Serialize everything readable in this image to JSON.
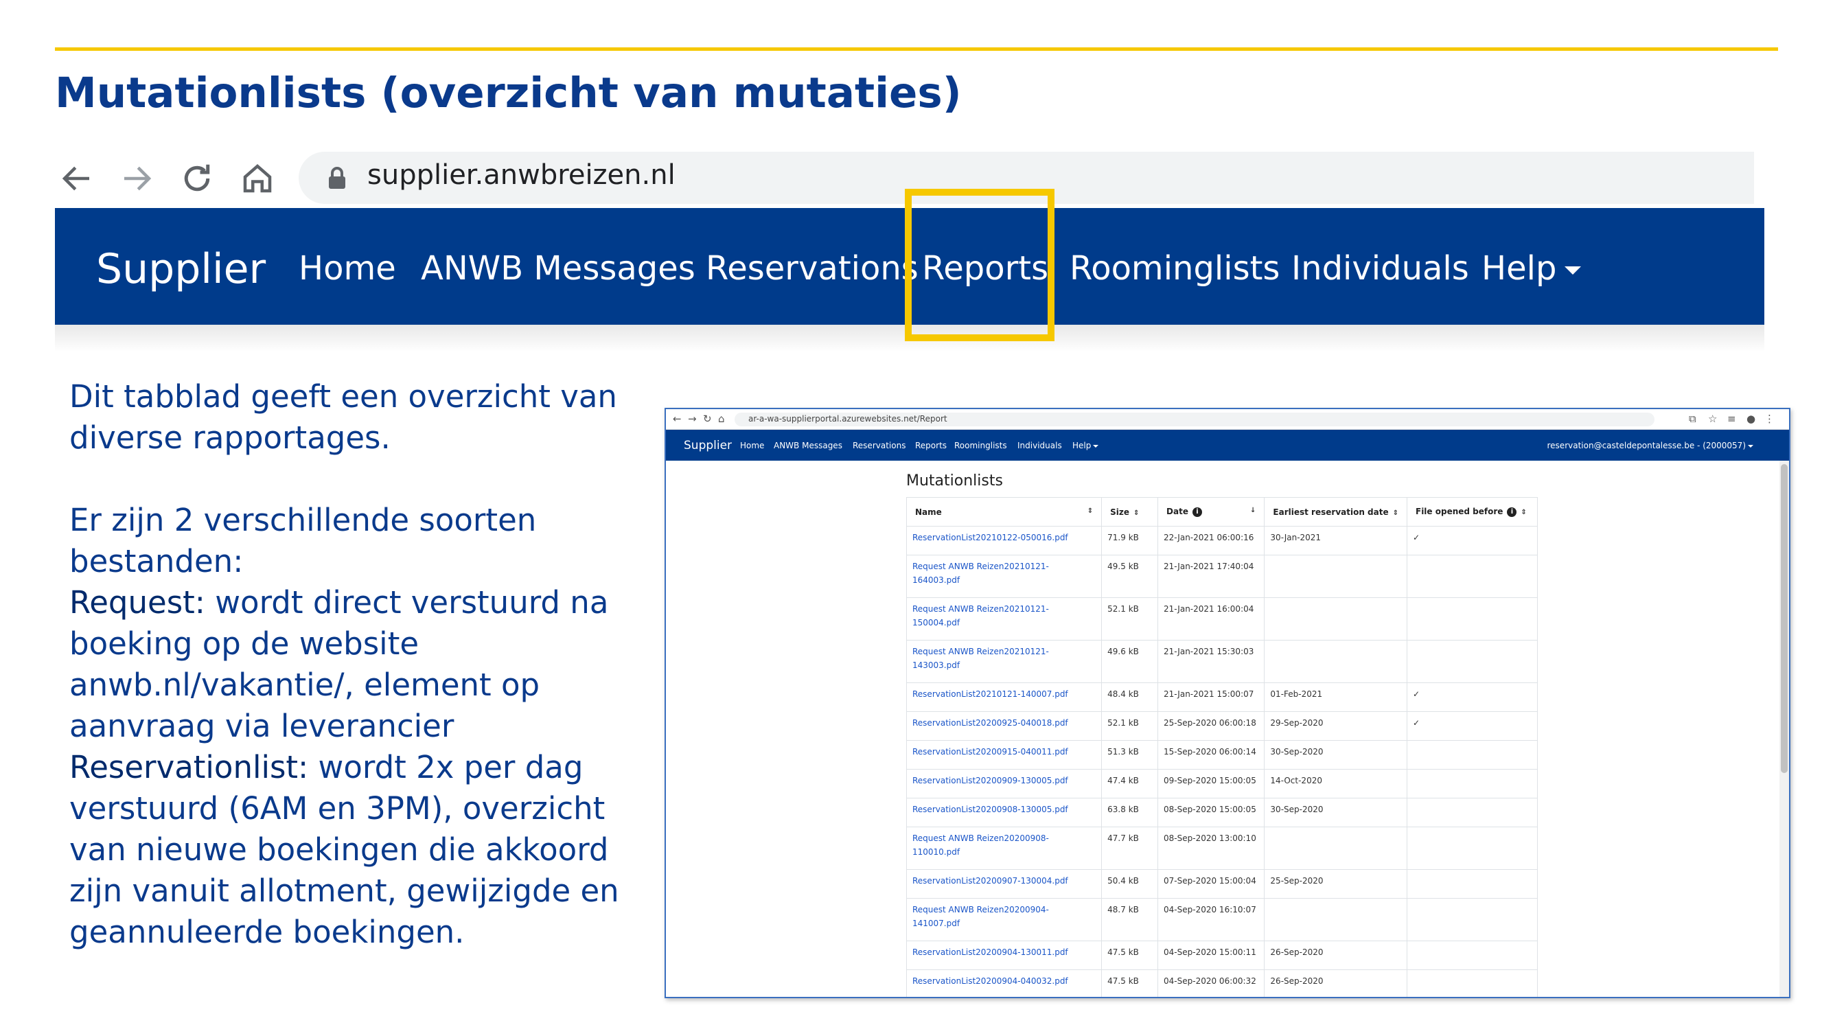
{
  "slide": {
    "title": "Mutationlists (overzicht van mutaties)",
    "accent_color": "#f6c800",
    "title_color": "#0a3a8c"
  },
  "browser": {
    "url": "supplier.anwbreizen.nl",
    "icons": [
      "back-icon",
      "forward-icon",
      "reload-icon",
      "home-icon",
      "lock-icon"
    ]
  },
  "nav": {
    "brand": "Supplier",
    "items": [
      "Home",
      "ANWB Messages",
      "Reservations",
      "Reports",
      "Roominglists",
      "Individuals",
      "Help"
    ],
    "highlighted": "Reports",
    "bg_color": "#003b8b"
  },
  "description": {
    "intro": "Dit tabblad geeft een overzicht van diverse rapportages.",
    "types_intro": "Er zijn 2 verschillende soorten bestanden:",
    "request_term": "Request:",
    "request_text": " wordt direct verstuurd na boeking op de website anwb.nl/vakantie/, element op aanvraag via leverancier",
    "reservationlist_term": "Reservationlist:",
    "reservationlist_text": " wordt 2x per dag verstuurd (6AM en 3PM), overzicht van nieuwe boekingen die akkoord zijn vanuit allotment, gewijzigde en geannuleerde boekingen."
  },
  "screenshot": {
    "url": "ar-a-wa-supplierportal.azurewebsites.net/Report",
    "nav_brand": "Supplier",
    "nav_items": [
      "Home",
      "ANWB Messages",
      "Reservations",
      "Reports",
      "Roominglists",
      "Individuals",
      "Help"
    ],
    "user": "reservation@casteldepontalesse.be - (2000057)",
    "title": "Mutationlists",
    "columns": [
      "Name",
      "Size",
      "Date",
      "Earliest reservation date",
      "File opened before"
    ],
    "rows": [
      {
        "name": "ReservationList20210122-050016.pdf",
        "size": "71.9 kB",
        "date": "22-Jan-2021 06:00:16",
        "earliest": "30-Jan-2021",
        "opened": "✓",
        "tall": false
      },
      {
        "name": "Request ANWB Reizen20210121-164003.pdf",
        "size": "49.5 kB",
        "date": "21-Jan-2021 17:40:04",
        "earliest": "",
        "opened": "",
        "tall": true
      },
      {
        "name": "Request ANWB Reizen20210121-150004.pdf",
        "size": "52.1 kB",
        "date": "21-Jan-2021 16:00:04",
        "earliest": "",
        "opened": "",
        "tall": true
      },
      {
        "name": "Request ANWB Reizen20210121-143003.pdf",
        "size": "49.6 kB",
        "date": "21-Jan-2021 15:30:03",
        "earliest": "",
        "opened": "",
        "tall": true
      },
      {
        "name": "ReservationList20210121-140007.pdf",
        "size": "48.4 kB",
        "date": "21-Jan-2021 15:00:07",
        "earliest": "01-Feb-2021",
        "opened": "✓",
        "tall": false
      },
      {
        "name": "ReservationList20200925-040018.pdf",
        "size": "52.1 kB",
        "date": "25-Sep-2020 06:00:18",
        "earliest": "29-Sep-2020",
        "opened": "✓",
        "tall": false
      },
      {
        "name": "ReservationList20200915-040011.pdf",
        "size": "51.3 kB",
        "date": "15-Sep-2020 06:00:14",
        "earliest": "30-Sep-2020",
        "opened": "",
        "tall": false
      },
      {
        "name": "ReservationList20200909-130005.pdf",
        "size": "47.4 kB",
        "date": "09-Sep-2020 15:00:05",
        "earliest": "14-Oct-2020",
        "opened": "",
        "tall": false
      },
      {
        "name": "ReservationList20200908-130005.pdf",
        "size": "63.8 kB",
        "date": "08-Sep-2020 15:00:05",
        "earliest": "30-Sep-2020",
        "opened": "",
        "tall": false
      },
      {
        "name": "Request ANWB Reizen20200908-110010.pdf",
        "size": "47.7 kB",
        "date": "08-Sep-2020 13:00:10",
        "earliest": "",
        "opened": "",
        "tall": true
      },
      {
        "name": "ReservationList20200907-130004.pdf",
        "size": "50.4 kB",
        "date": "07-Sep-2020 15:00:04",
        "earliest": "25-Sep-2020",
        "opened": "",
        "tall": false
      },
      {
        "name": "Request ANWB Reizen20200904-141007.pdf",
        "size": "48.7 kB",
        "date": "04-Sep-2020 16:10:07",
        "earliest": "",
        "opened": "",
        "tall": true
      },
      {
        "name": "ReservationList20200904-130011.pdf",
        "size": "47.5 kB",
        "date": "04-Sep-2020 15:00:11",
        "earliest": "26-Sep-2020",
        "opened": "",
        "tall": false
      },
      {
        "name": "ReservationList20200904-040032.pdf",
        "size": "47.5 kB",
        "date": "04-Sep-2020 06:00:32",
        "earliest": "26-Sep-2020",
        "opened": "",
        "tall": false
      }
    ]
  }
}
